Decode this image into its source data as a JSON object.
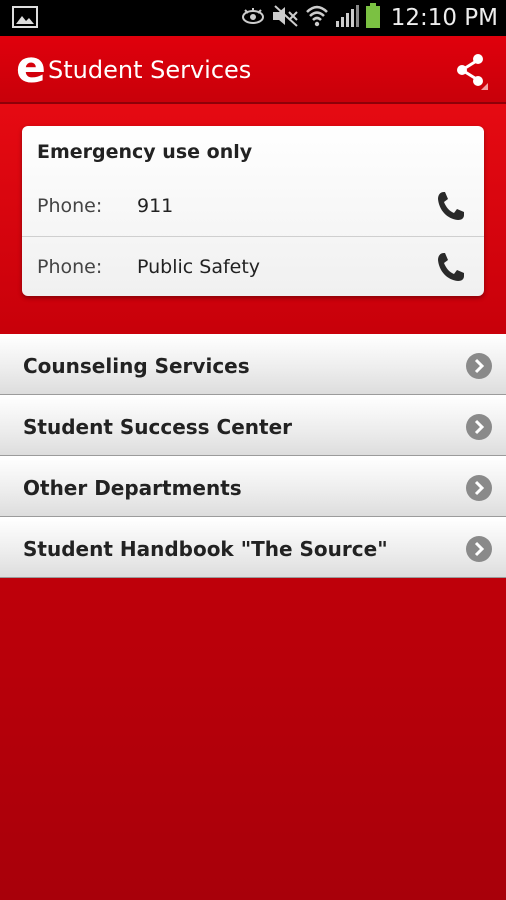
{
  "status_bar": {
    "time": "12:10 PM",
    "icons": [
      "image-icon",
      "eye-icon",
      "mute-icon",
      "wifi-icon",
      "signal-icon",
      "battery-icon"
    ]
  },
  "action_bar": {
    "logo": "e",
    "title": "Student Services",
    "share_icon": "share-icon"
  },
  "emergency": {
    "title": "Emergency use only",
    "contacts": [
      {
        "label": "Phone:",
        "value": "911"
      },
      {
        "label": "Phone:",
        "value": "Public Safety"
      }
    ]
  },
  "menu": {
    "items": [
      {
        "label": "Counseling Services"
      },
      {
        "label": "Student Success Center"
      },
      {
        "label": "Other Departments"
      },
      {
        "label": "Student Handbook \"The Source\""
      }
    ]
  },
  "colors": {
    "brand_red": "#d0000a",
    "status_bar": "#000000"
  }
}
